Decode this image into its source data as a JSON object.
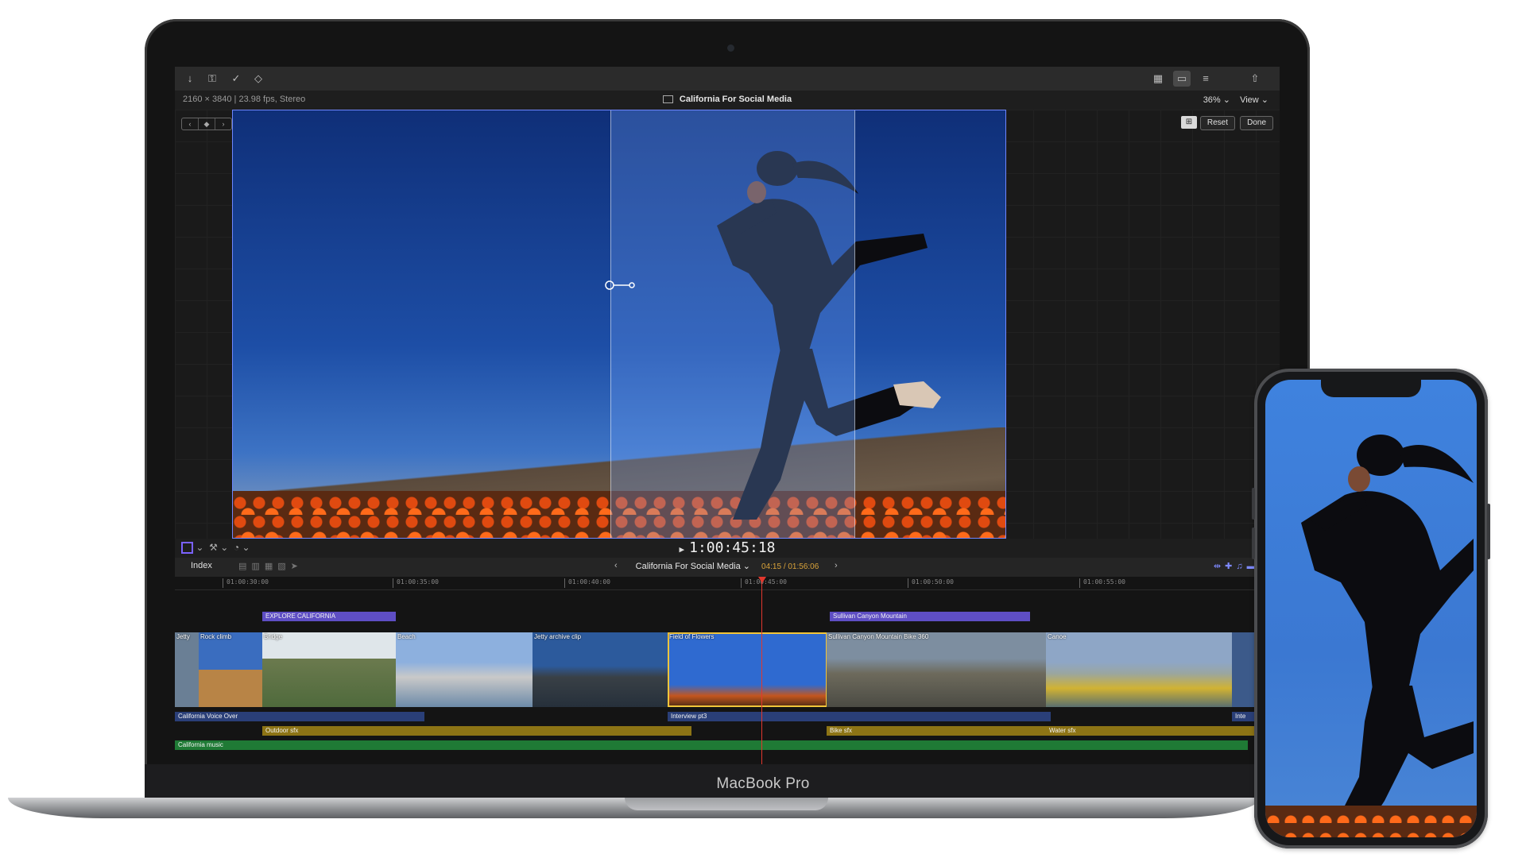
{
  "toolbar": {
    "icons": [
      "import-icon",
      "key-icon",
      "check-icon",
      "tag-icon",
      "browser-icon",
      "timeline-icon",
      "inspector-icon",
      "share-icon"
    ]
  },
  "infobar": {
    "format": "2160 × 3840 | 23.98 fps, Stereo",
    "project_title": "California For Social Media",
    "zoom": "36%",
    "view": "View"
  },
  "viewer": {
    "reset_label": "Reset",
    "done_label": "Done"
  },
  "playback": {
    "timecode": "1:00:45:18"
  },
  "timeline_header": {
    "index_label": "Index",
    "project_title": "California For Social Media",
    "duration": "04:15 / 01:56:06"
  },
  "ruler": {
    "ticks": [
      "01:00:30:00",
      "01:00:35:00",
      "01:00:40:00",
      "01:00:45:00",
      "01:00:50:00",
      "01:00:55:00"
    ]
  },
  "timeline": {
    "titles": [
      "EXPLORE CALIFORNIA",
      "Sullivan Canyon Mountain"
    ],
    "clips": [
      "Jetty",
      "Rock climb",
      "Bridge",
      "Beach",
      "Jetty archive clip",
      "Field of Flowers",
      "Sullivan Canyon Mountain Bike 360",
      "Canoe"
    ],
    "audio": {
      "voice_over": "California Voice Over",
      "interview": "Interview pt3",
      "interview_next": "Inte",
      "outdoor_sfx": "Outdoor sfx",
      "bike_sfx": "Bike sfx",
      "water_sfx": "Water sfx",
      "music": "California music"
    }
  },
  "device": {
    "brand": "MacBook Pro"
  },
  "colors": {
    "accent": "#7b62ff",
    "playhead": "#e2372d",
    "selection": "#f2c53a",
    "duration": "#d8a23a"
  }
}
